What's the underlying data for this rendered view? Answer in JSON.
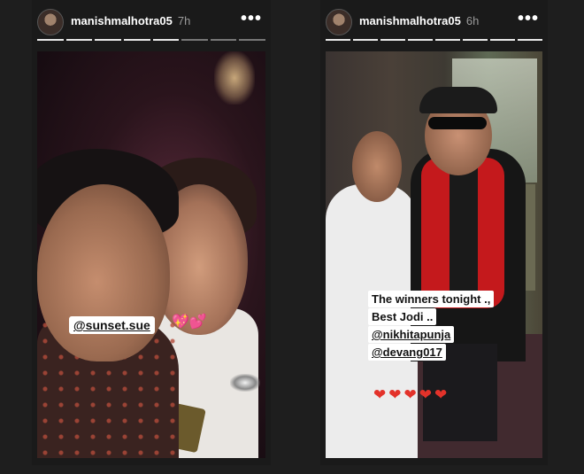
{
  "stories": [
    {
      "username": "manishmalhotra05",
      "time": "7h",
      "more_label": "•••",
      "mention": "@sunset.sue",
      "sticker": "💖💕"
    },
    {
      "username": "manishmalhotra05",
      "time": "6h",
      "more_label": "•••",
      "caption_lines": [
        "The winners tonight .,",
        "Best Jodi ..",
        "@nikhitapunja",
        "@devang017"
      ],
      "hearts": "❤❤❤❤❤"
    }
  ],
  "icons": {
    "more": "more-options-icon",
    "heart": "heart-icon"
  },
  "colors": {
    "background": "#1e1e1e",
    "heart": "#e3322a",
    "sticker_pink": "#ff5aa8"
  }
}
